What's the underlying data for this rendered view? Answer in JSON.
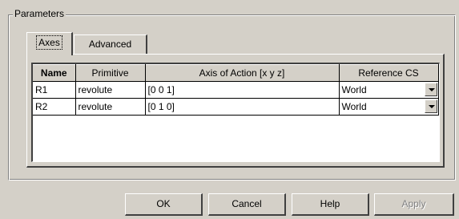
{
  "group_title": "Parameters",
  "tabs": {
    "axes": "Axes",
    "advanced": "Advanced"
  },
  "table": {
    "headers": {
      "name": "Name",
      "primitive": "Primitive",
      "axis": "Axis of Action [x y z]",
      "reference": "Reference CS"
    },
    "rows": [
      {
        "name": "R1",
        "primitive": "revolute",
        "axis": "[0 0 1]",
        "reference": "World"
      },
      {
        "name": "R2",
        "primitive": "revolute",
        "axis": "[0 1 0]",
        "reference": "World"
      }
    ]
  },
  "buttons": {
    "ok": "OK",
    "cancel": "Cancel",
    "help": "Help",
    "apply": "Apply"
  }
}
